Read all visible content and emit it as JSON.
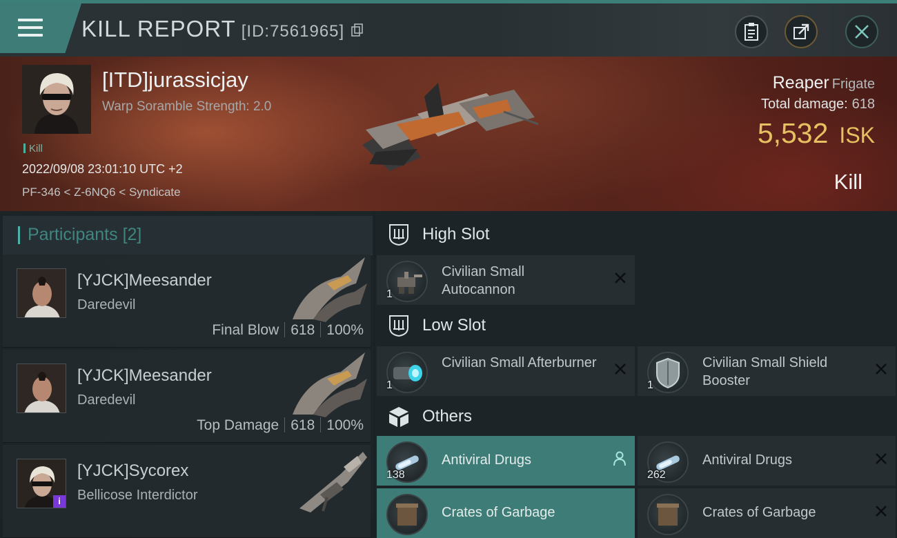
{
  "header": {
    "title": "KILL REPORT",
    "report_id": "[ID:7561965]",
    "buttons": {
      "clipboard": "clipboard-icon",
      "share": "share-icon",
      "close": "close-icon"
    }
  },
  "victim": {
    "name": "[ITD]jurassicjay",
    "scramble": "Warp Soramble Strength: 2.0",
    "tag": "Kill",
    "datetime": "2022/09/08 23:01:10 UTC +2",
    "location": "PF-346 < Z-6NQ6 < Syndicate",
    "ship_name": "Reaper",
    "ship_class": "Frigate",
    "damage_label": "Total damage:",
    "damage_value": "618",
    "isk_value": "5,532",
    "isk_unit": "ISK",
    "result": "Kill"
  },
  "participants": {
    "title": "Participants",
    "count": "[2]",
    "rows": [
      {
        "name": "[YJCK]Meesander",
        "ship": "Daredevil",
        "role": "Final Blow",
        "damage": "618",
        "percent": "100%"
      },
      {
        "name": "[YJCK]Meesander",
        "ship": "Daredevil",
        "role": "Top Damage",
        "damage": "618",
        "percent": "100%"
      },
      {
        "name": "[YJCK]Sycorex",
        "ship": "Bellicose Interdictor",
        "badge": "i"
      }
    ]
  },
  "fitting": {
    "high_slot": {
      "title": "High Slot",
      "items": [
        {
          "name": "Civilian Small Autocannon",
          "qty": "1"
        }
      ]
    },
    "low_slot": {
      "title": "Low Slot",
      "items": [
        {
          "name": "Civilian Small Afterburner",
          "qty": "1"
        },
        {
          "name": "Civilian Small Shield Booster",
          "qty": "1"
        }
      ]
    },
    "others": {
      "title": "Others",
      "items": [
        {
          "name": "Antiviral Drugs",
          "qty": "138"
        },
        {
          "name": "Antiviral Drugs",
          "qty": "262"
        },
        {
          "name": "Crates of Garbage"
        },
        {
          "name": "Crates of Garbage"
        }
      ]
    }
  },
  "colors": {
    "accent": "#3e7d77",
    "isk": "#e6c061",
    "background": "#1d2427"
  }
}
